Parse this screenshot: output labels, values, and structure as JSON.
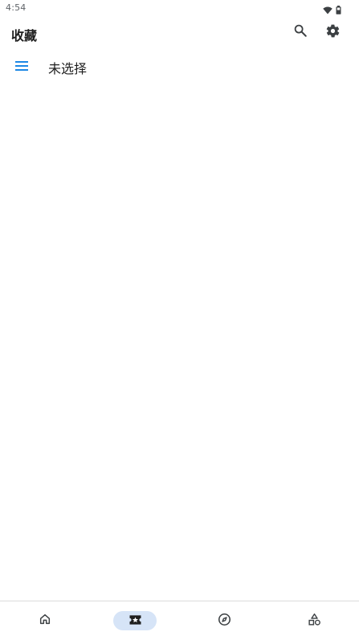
{
  "status_bar": {
    "time": "4:54",
    "icons": [
      "wifi-icon",
      "battery-icon"
    ]
  },
  "app_bar": {
    "title": "收藏",
    "actions": [
      "search-icon",
      "settings-icon"
    ]
  },
  "category": {
    "icon": "menu-icon",
    "label": "未选择"
  },
  "bottom_nav": {
    "items": [
      {
        "icon": "home-icon",
        "selected": false
      },
      {
        "icon": "favorites-icon",
        "selected": true
      },
      {
        "icon": "explore-icon",
        "selected": false
      },
      {
        "icon": "more-icon",
        "selected": false
      }
    ]
  },
  "colors": {
    "accent": "#1e88e5",
    "nav_selected_bg": "#d6e4f7",
    "text_primary": "#1f1f1f",
    "icon": "#3c4043"
  }
}
